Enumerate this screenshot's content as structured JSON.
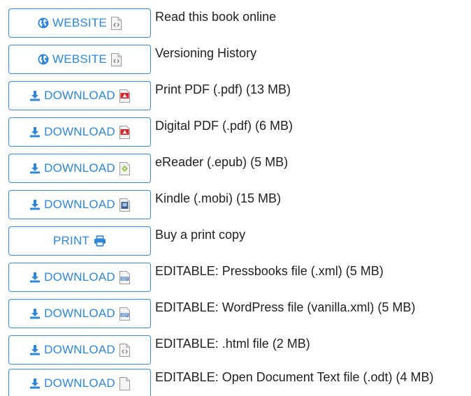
{
  "rows": [
    {
      "button": "WEBSITE",
      "lead": "globe-icon",
      "trail": "html-file-icon",
      "text": "Read this book online"
    },
    {
      "button": "WEBSITE",
      "lead": "globe-icon",
      "trail": "html-file-icon",
      "text": "Versioning History"
    },
    {
      "button": "DOWNLOAD",
      "lead": "download-icon",
      "trail": "pdf-file-icon",
      "text": "Print PDF (.pdf) (13 MB)"
    },
    {
      "button": "DOWNLOAD",
      "lead": "download-icon",
      "trail": "pdf-file-icon",
      "text": "Digital PDF (.pdf) (6 MB)"
    },
    {
      "button": "DOWNLOAD",
      "lead": "download-icon",
      "trail": "epub-file-icon",
      "text": "eReader (.epub) (5 MB)"
    },
    {
      "button": "DOWNLOAD",
      "lead": "download-icon",
      "trail": "mobi-file-icon",
      "text": "Kindle (.mobi) (15 MB)"
    },
    {
      "button": "PRINT",
      "lead": "",
      "trail": "printer-icon",
      "text": "Buy a print copy"
    },
    {
      "button": "DOWNLOAD",
      "lead": "download-icon",
      "trail": "xml-file-icon",
      "text": "EDITABLE: Pressbooks file (.xml) (5 MB)"
    },
    {
      "button": "DOWNLOAD",
      "lead": "download-icon",
      "trail": "xml-file-icon",
      "text": "EDITABLE: WordPress file (vanilla.xml) (5 MB)"
    },
    {
      "button": "DOWNLOAD",
      "lead": "download-icon",
      "trail": "html-file-icon",
      "text": "EDITABLE: .html file (2 MB)"
    },
    {
      "button": "DOWNLOAD",
      "lead": "download-icon",
      "trail": "blank-file-icon",
      "text": "EDITABLE: Open Document Text file (.odt) (4 MB)"
    }
  ],
  "colors": {
    "accent": "#2f86d6",
    "border": "#3b8ad8",
    "pdf": "#d9232d",
    "epub": "#8cc63f",
    "mobi": "#3a5f8f",
    "text": "#222222"
  }
}
